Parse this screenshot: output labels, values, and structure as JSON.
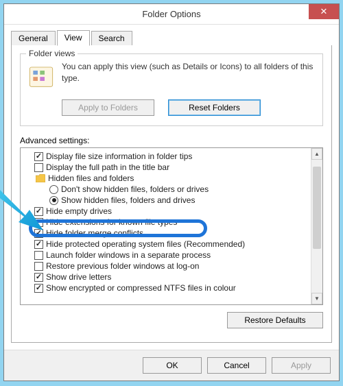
{
  "window": {
    "title": "Folder Options"
  },
  "tabs": {
    "general": "General",
    "view": "View",
    "search": "Search"
  },
  "folder_views": {
    "legend": "Folder views",
    "text": "You can apply this view (such as Details or Icons) to all folders of this type.",
    "apply_btn": "Apply to Folders",
    "reset_btn": "Reset Folders"
  },
  "advanced": {
    "label": "Advanced settings:",
    "items": [
      {
        "type": "chk",
        "checked": true,
        "label": "Display file size information in folder tips"
      },
      {
        "type": "chk",
        "checked": false,
        "label": "Display the full path in the title bar"
      },
      {
        "type": "folder",
        "label": "Hidden files and folders"
      },
      {
        "type": "rad",
        "checked": false,
        "label": "Don't show hidden files, folders or drives"
      },
      {
        "type": "rad",
        "checked": true,
        "label": "Show hidden files, folders and drives"
      },
      {
        "type": "chk",
        "checked": true,
        "label": "Hide empty drives"
      },
      {
        "type": "chk",
        "checked": false,
        "label": "Hide extensions for known file types",
        "highlight": true
      },
      {
        "type": "chk",
        "checked": true,
        "label": "Hide folder merge conflicts"
      },
      {
        "type": "chk",
        "checked": true,
        "label": "Hide protected operating system files (Recommended)"
      },
      {
        "type": "chk",
        "checked": false,
        "label": "Launch folder windows in a separate process"
      },
      {
        "type": "chk",
        "checked": false,
        "label": "Restore previous folder windows at log-on"
      },
      {
        "type": "chk",
        "checked": true,
        "label": "Show drive letters"
      },
      {
        "type": "chk",
        "checked": true,
        "label": "Show encrypted or compressed NTFS files in colour"
      }
    ],
    "restore_btn": "Restore Defaults"
  },
  "buttons": {
    "ok": "OK",
    "cancel": "Cancel",
    "apply": "Apply"
  }
}
